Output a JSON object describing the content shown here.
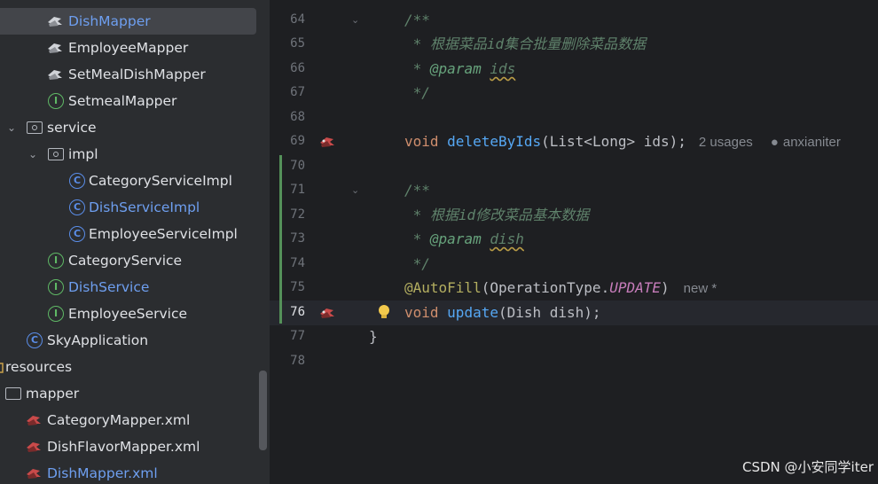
{
  "tree": {
    "items": [
      {
        "label": "DishMapper",
        "icon": "mybatis-bird-icon",
        "selected": true
      },
      {
        "label": "EmployeeMapper",
        "icon": "mybatis-bird-icon"
      },
      {
        "label": "SetMealDishMapper",
        "icon": "mybatis-bird-icon"
      },
      {
        "label": "SetmealMapper",
        "icon": "interface-icon"
      },
      {
        "label": "service",
        "icon": "package-folder-icon"
      },
      {
        "label": "impl",
        "icon": "package-folder-icon"
      },
      {
        "label": "CategoryServiceImpl",
        "icon": "class-icon"
      },
      {
        "label": "DishServiceImpl",
        "icon": "class-icon"
      },
      {
        "label": "EmployeeServiceImpl",
        "icon": "class-icon"
      },
      {
        "label": "CategoryService",
        "icon": "interface-icon"
      },
      {
        "label": "DishService",
        "icon": "interface-icon"
      },
      {
        "label": "EmployeeService",
        "icon": "interface-icon"
      },
      {
        "label": "SkyApplication",
        "icon": "spring-app-class-icon"
      },
      {
        "label": "resources",
        "icon": "resources-folder-icon"
      },
      {
        "label": "mapper",
        "icon": "folder-icon"
      },
      {
        "label": "CategoryMapper.xml",
        "icon": "mybatis-xml-icon"
      },
      {
        "label": "DishFlavorMapper.xml",
        "icon": "mybatis-xml-icon"
      },
      {
        "label": "DishMapper.xml",
        "icon": "mybatis-xml-icon"
      }
    ],
    "icon_letters": {
      "interface": "I",
      "class": "C"
    }
  },
  "editor": {
    "lines": [
      {
        "num": "64"
      },
      {
        "num": "65"
      },
      {
        "num": "66"
      },
      {
        "num": "67"
      },
      {
        "num": "68"
      },
      {
        "num": "69"
      },
      {
        "num": "70"
      },
      {
        "num": "71"
      },
      {
        "num": "72"
      },
      {
        "num": "73"
      },
      {
        "num": "74"
      },
      {
        "num": "75"
      },
      {
        "num": "76"
      },
      {
        "num": "77"
      },
      {
        "num": "78"
      }
    ],
    "code": {
      "l64": "/**",
      "l65": " * 根据菜品id集合批量删除菜品数据",
      "l66_star": " * ",
      "l66_tag": "@param",
      "l66_sp": " ",
      "l66_name": "ids",
      "l67": " */",
      "l69_kw": "void",
      "l69_sp": " ",
      "l69_fn": "deleteByIds",
      "l69_rest": "(List<Long> ids);",
      "l69_usages": "2 usages",
      "l69_author": "anxianiter",
      "l71": "/**",
      "l72": " * 根据id修改菜品基本数据",
      "l73_star": " * ",
      "l73_tag": "@param",
      "l73_sp": " ",
      "l73_name": "dish",
      "l74": " */",
      "l75_ann": "@AutoFill",
      "l75_open": "(OperationType.",
      "l75_const": "UPDATE",
      "l75_close": ")",
      "l75_new": "new *",
      "l76_kw": "void",
      "l76_sp": " ",
      "l76_fn": "update",
      "l76_rest": "(Dish dish);",
      "l77": "}"
    }
  },
  "watermark": "CSDN @小安同学iter",
  "colors": {
    "sidebar_bg": "#2b2d30",
    "editor_bg": "#1e1f22",
    "comment": "#5f826b",
    "keyword": "#cf8e6d",
    "function": "#56a8f5",
    "annotation": "#b3ae60",
    "constant": "#c77dbb",
    "vcs_modified": "#549159"
  }
}
